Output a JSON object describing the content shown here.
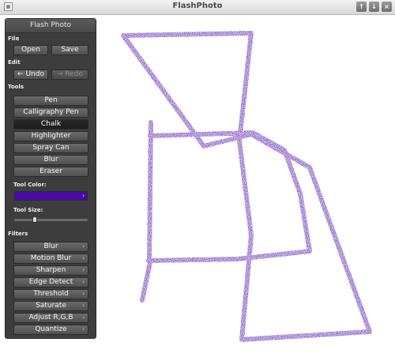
{
  "window": {
    "title": "FlashPhoto",
    "controls": [
      "↑",
      "↓",
      "×"
    ]
  },
  "panel": {
    "title": "Flash Photo",
    "file": {
      "label": "File",
      "open": "Open",
      "save": "Save"
    },
    "edit": {
      "label": "Edit",
      "undo": "Undo",
      "redo": "Redo",
      "undo_icon": "←",
      "redo_icon": "→"
    },
    "tools": {
      "label": "Tools",
      "items": [
        "Pen",
        "Calligraphy Pen",
        "Chalk",
        "Highlighter",
        "Spray Can",
        "Blur",
        "Eraser"
      ],
      "selected": "Chalk",
      "color_label": "Tool Color:",
      "color": "#4a0aa8",
      "size_label": "Tool Size:",
      "size_fraction": 0.27
    },
    "filters": {
      "label": "Filters",
      "items": [
        "Blur",
        "Motion Blur",
        "Sharpen",
        "Edge Detect",
        "Threshold",
        "Saturate",
        "Adjust R,G,B",
        "Quantize"
      ]
    }
  },
  "canvas": {
    "stroke_color": "#4a0aa8"
  }
}
